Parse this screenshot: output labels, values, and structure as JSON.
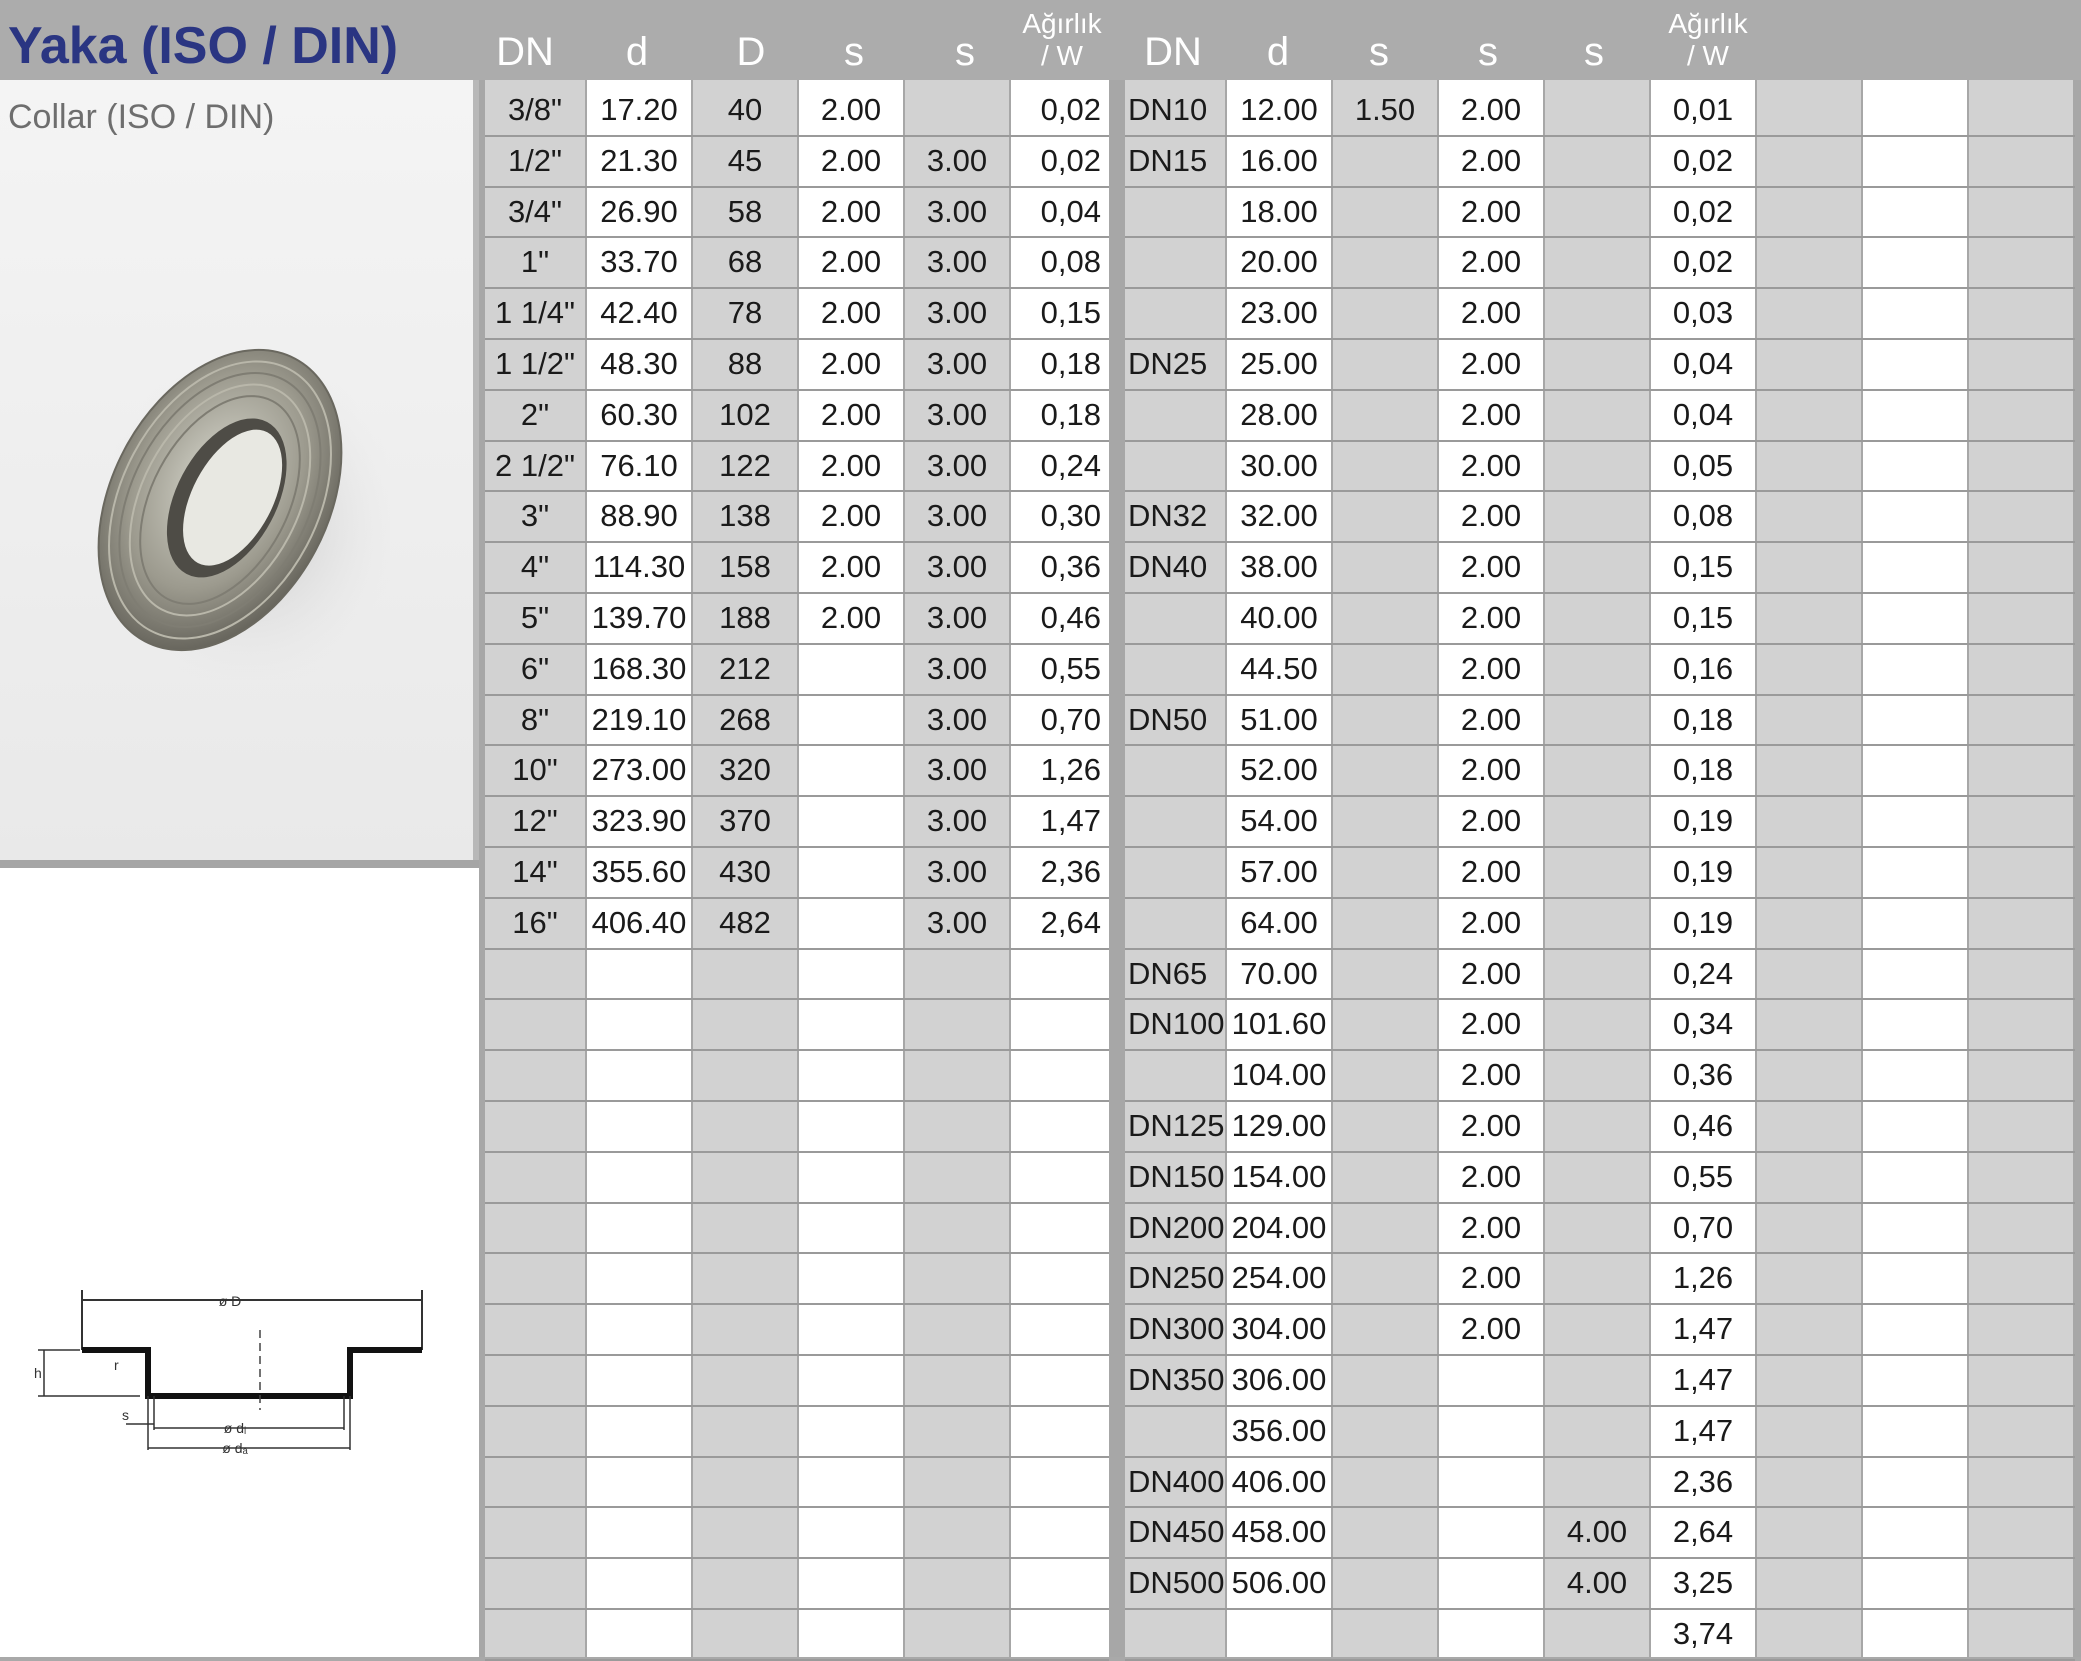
{
  "header": {
    "title": "Yaka (ISO / DIN)",
    "subtitle": "Collar (ISO / DIN)",
    "left_columns": [
      "DN",
      "d",
      "D",
      "s",
      "s"
    ],
    "left_weight": [
      "Ağırlık",
      "/ W"
    ],
    "right_columns": [
      "DN",
      "d",
      "s",
      "s",
      "s"
    ],
    "right_weight": [
      "Ağırlık",
      "/ W"
    ]
  },
  "drawing_labels": {
    "outer_diameter": "ø D",
    "height": "h",
    "thickness": "s",
    "r": "r",
    "inner_diameter": "ø dᵢ",
    "outer_pipe_diameter": "ø dₐ"
  },
  "iso_table": [
    [
      "3/8\"",
      "17.20",
      "40",
      "2.00",
      "",
      "0,02"
    ],
    [
      "1/2\"",
      "21.30",
      "45",
      "2.00",
      "3.00",
      "0,02"
    ],
    [
      "3/4\"",
      "26.90",
      "58",
      "2.00",
      "3.00",
      "0,04"
    ],
    [
      "1\"",
      "33.70",
      "68",
      "2.00",
      "3.00",
      "0,08"
    ],
    [
      "1 1/4\"",
      "42.40",
      "78",
      "2.00",
      "3.00",
      "0,15"
    ],
    [
      "1 1/2\"",
      "48.30",
      "88",
      "2.00",
      "3.00",
      "0,18"
    ],
    [
      "2\"",
      "60.30",
      "102",
      "2.00",
      "3.00",
      "0,18"
    ],
    [
      "2 1/2\"",
      "76.10",
      "122",
      "2.00",
      "3.00",
      "0,24"
    ],
    [
      "3\"",
      "88.90",
      "138",
      "2.00",
      "3.00",
      "0,30"
    ],
    [
      "4\"",
      "114.30",
      "158",
      "2.00",
      "3.00",
      "0,36"
    ],
    [
      "5\"",
      "139.70",
      "188",
      "2.00",
      "3.00",
      "0,46"
    ],
    [
      "6\"",
      "168.30",
      "212",
      "",
      "3.00",
      "0,55"
    ],
    [
      "8\"",
      "219.10",
      "268",
      "",
      "3.00",
      "0,70"
    ],
    [
      "10\"",
      "273.00",
      "320",
      "",
      "3.00",
      "1,26"
    ],
    [
      "12\"",
      "323.90",
      "370",
      "",
      "3.00",
      "1,47"
    ],
    [
      "14\"",
      "355.60",
      "430",
      "",
      "3.00",
      "2,36"
    ],
    [
      "16\"",
      "406.40",
      "482",
      "",
      "3.00",
      "2,64"
    ]
  ],
  "din_table": [
    [
      "DN10",
      "12.00",
      "1.50",
      "2.00",
      "",
      "0,01"
    ],
    [
      "DN15",
      "16.00",
      "",
      "2.00",
      "",
      "0,02"
    ],
    [
      "",
      "18.00",
      "",
      "2.00",
      "",
      "0,02"
    ],
    [
      "",
      "20.00",
      "",
      "2.00",
      "",
      "0,02"
    ],
    [
      "",
      "23.00",
      "",
      "2.00",
      "",
      "0,03"
    ],
    [
      "DN25",
      "25.00",
      "",
      "2.00",
      "",
      "0,04"
    ],
    [
      "",
      "28.00",
      "",
      "2.00",
      "",
      "0,04"
    ],
    [
      "",
      "30.00",
      "",
      "2.00",
      "",
      "0,05"
    ],
    [
      "DN32",
      "32.00",
      "",
      "2.00",
      "",
      "0,08"
    ],
    [
      "DN40",
      "38.00",
      "",
      "2.00",
      "",
      "0,15"
    ],
    [
      "",
      "40.00",
      "",
      "2.00",
      "",
      "0,15"
    ],
    [
      "",
      "44.50",
      "",
      "2.00",
      "",
      "0,16"
    ],
    [
      "DN50",
      "51.00",
      "",
      "2.00",
      "",
      "0,18"
    ],
    [
      "",
      "52.00",
      "",
      "2.00",
      "",
      "0,18"
    ],
    [
      "",
      "54.00",
      "",
      "2.00",
      "",
      "0,19"
    ],
    [
      "",
      "57.00",
      "",
      "2.00",
      "",
      "0,19"
    ],
    [
      "",
      "64.00",
      "",
      "2.00",
      "",
      "0,19"
    ],
    [
      "DN65",
      "70.00",
      "",
      "2.00",
      "",
      "0,24"
    ],
    [
      "DN100",
      "101.60",
      "",
      "2.00",
      "",
      "0,34"
    ],
    [
      "",
      "104.00",
      "",
      "2.00",
      "",
      "0,36"
    ],
    [
      "DN125",
      "129.00",
      "",
      "2.00",
      "",
      "0,46"
    ],
    [
      "DN150",
      "154.00",
      "",
      "2.00",
      "",
      "0,55"
    ],
    [
      "DN200",
      "204.00",
      "",
      "2.00",
      "",
      "0,70"
    ],
    [
      "DN250",
      "254.00",
      "",
      "2.00",
      "",
      "1,26"
    ],
    [
      "DN300",
      "304.00",
      "",
      "2.00",
      "",
      "1,47"
    ],
    [
      "DN350",
      "306.00",
      "",
      "",
      "",
      "1,47"
    ],
    [
      "",
      "356.00",
      "",
      "",
      "",
      "1,47"
    ],
    [
      "DN400",
      "406.00",
      "",
      "",
      "",
      "2,36"
    ],
    [
      "DN450",
      "458.00",
      "",
      "",
      "4.00",
      "2,64"
    ],
    [
      "DN500",
      "506.00",
      "",
      "",
      "4.00",
      "3,25"
    ],
    [
      "",
      "",
      "",
      "",
      "",
      "3,74"
    ]
  ]
}
